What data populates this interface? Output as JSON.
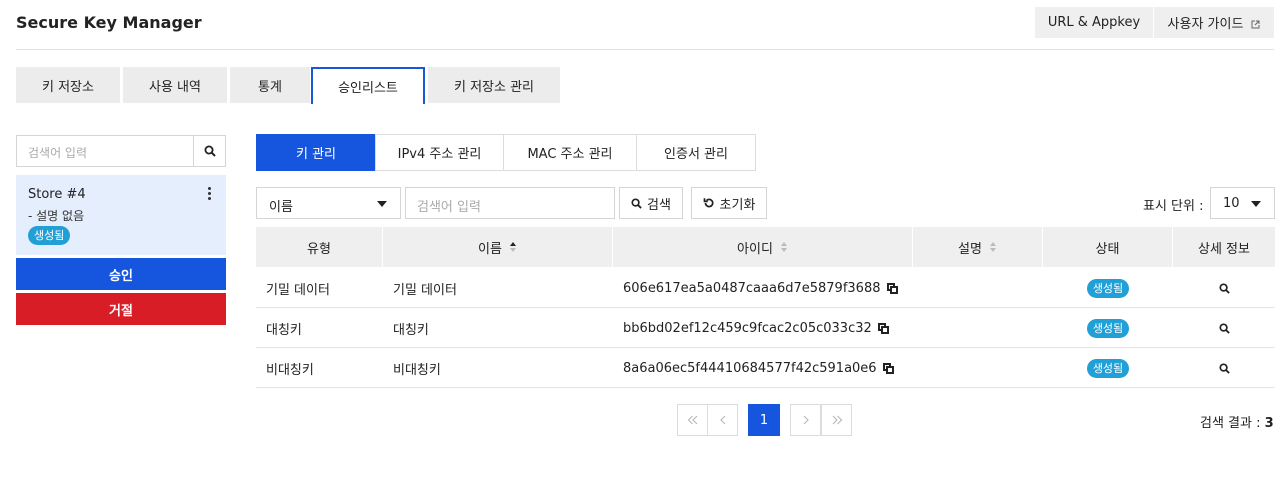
{
  "header": {
    "title": "Secure Key Manager",
    "url_appkey_label": "URL & Appkey",
    "user_guide_label": "사용자 가이드"
  },
  "tabs": [
    {
      "label": "키 저장소",
      "active": false
    },
    {
      "label": "사용 내역",
      "active": false
    },
    {
      "label": "통계",
      "active": false
    },
    {
      "label": "승인리스트",
      "active": true
    },
    {
      "label": "키 저장소 관리",
      "active": false
    }
  ],
  "sidebar": {
    "search_placeholder": "검색어 입력",
    "store": {
      "name": "Store #4",
      "description": "- 설명 없음",
      "status": "생성됨"
    },
    "approve_label": "승인",
    "reject_label": "거절"
  },
  "subtabs": [
    {
      "label": "키 관리",
      "active": true
    },
    {
      "label": "IPv4 주소 관리",
      "active": false
    },
    {
      "label": "MAC 주소 관리",
      "active": false
    },
    {
      "label": "인증서 관리",
      "active": false
    }
  ],
  "filter": {
    "field_selected": "이름",
    "search_placeholder": "검색어 입력",
    "search_label": "검색",
    "reset_label": "초기화",
    "unit_label": "표시 단위 :",
    "unit_value": "10"
  },
  "table": {
    "columns": [
      "유형",
      "이름",
      "아이디",
      "설명",
      "상태",
      "상세 정보"
    ],
    "rows": [
      {
        "type": "기밀 데이터",
        "name": "기밀 데이터",
        "id": "606e617ea5a0487caaa6d7e5879f3688",
        "desc": "",
        "status": "생성됨"
      },
      {
        "type": "대칭키",
        "name": "대칭키",
        "id": "bb6bd02ef12c459c9fcac2c05c033c32",
        "desc": "",
        "status": "생성됨"
      },
      {
        "type": "비대칭키",
        "name": "비대칭키",
        "id": "8a6a06ec5f44410684577f42c591a0e6",
        "desc": "",
        "status": "생성됨"
      }
    ]
  },
  "pagination": {
    "current_page": "1",
    "result_label": "검색 결과 :",
    "result_count": "3"
  },
  "colors": {
    "primary": "#1656df",
    "danger": "#d81d26",
    "badge": "#21a0d8"
  }
}
